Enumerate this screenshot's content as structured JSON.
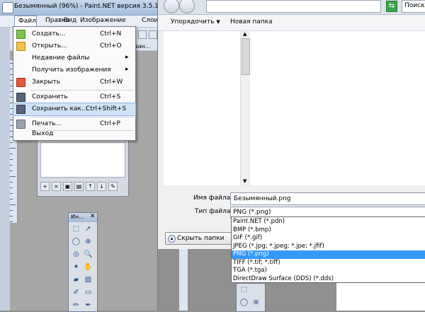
{
  "app": {
    "title": "Безымянный (96%) - Paint.NET версия 3.5.10",
    "menu": [
      "Файл",
      "Правка",
      "Вид",
      "Изображение",
      "Слои"
    ],
    "toolbar_hint": "ван..."
  },
  "file_menu": {
    "items": [
      {
        "label": "Создать...",
        "shortcut": "Ctrl+N",
        "icon": "new-file-icon"
      },
      {
        "label": "Открыть...",
        "shortcut": "Ctrl+O",
        "icon": "open-folder-icon"
      },
      {
        "label": "Недавние файлы",
        "shortcut": "",
        "icon": ""
      },
      {
        "label": "Получить изображения",
        "shortcut": "",
        "icon": ""
      },
      {
        "label": "Закрыть",
        "shortcut": "Ctrl+W",
        "icon": "close-doc-icon"
      },
      {
        "label": "Сохранить",
        "shortcut": "Ctrl+S",
        "icon": "save-icon"
      },
      {
        "label": "Сохранить как...",
        "shortcut": "Ctrl+Shift+S",
        "icon": "save-as-icon"
      },
      {
        "label": "Печать...",
        "shortcut": "Ctrl+P",
        "icon": "print-icon"
      },
      {
        "label": "Выход",
        "shortcut": "",
        "icon": ""
      }
    ],
    "submenu_arrow": "▸",
    "selected_index": 6
  },
  "tools_window": {
    "title": "Ин..."
  },
  "dialog": {
    "search_label": "Поиск",
    "organize_label": "Упорядочить",
    "organize_arrow": "▼",
    "new_folder_label": "Новая папка",
    "filename_label": "Имя файла:",
    "filename_value": "Безымянный.png",
    "filetype_label": "Тип файла:",
    "filetype_value": "PNG (*.png)",
    "hide_folders_label": "Скрыть папки",
    "filetype_options": [
      "Paint.NET (*.pdn)",
      "BMP (*.bmp)",
      "GIF (*.gif)",
      "JPEG (*.jpg; *.jpeg; *.jpe; *.jfif)",
      "PNG (*.png)",
      "TIFF (*.tif; *.tiff)",
      "TGA (*.tga)",
      "DirectDraw Surface (DDS) (*.dds)"
    ],
    "selected_type_index": 4
  },
  "colors": {
    "selection": "#3399ff",
    "menu_highlight": "#cfe3f7",
    "go_button": "#3aa54a"
  }
}
